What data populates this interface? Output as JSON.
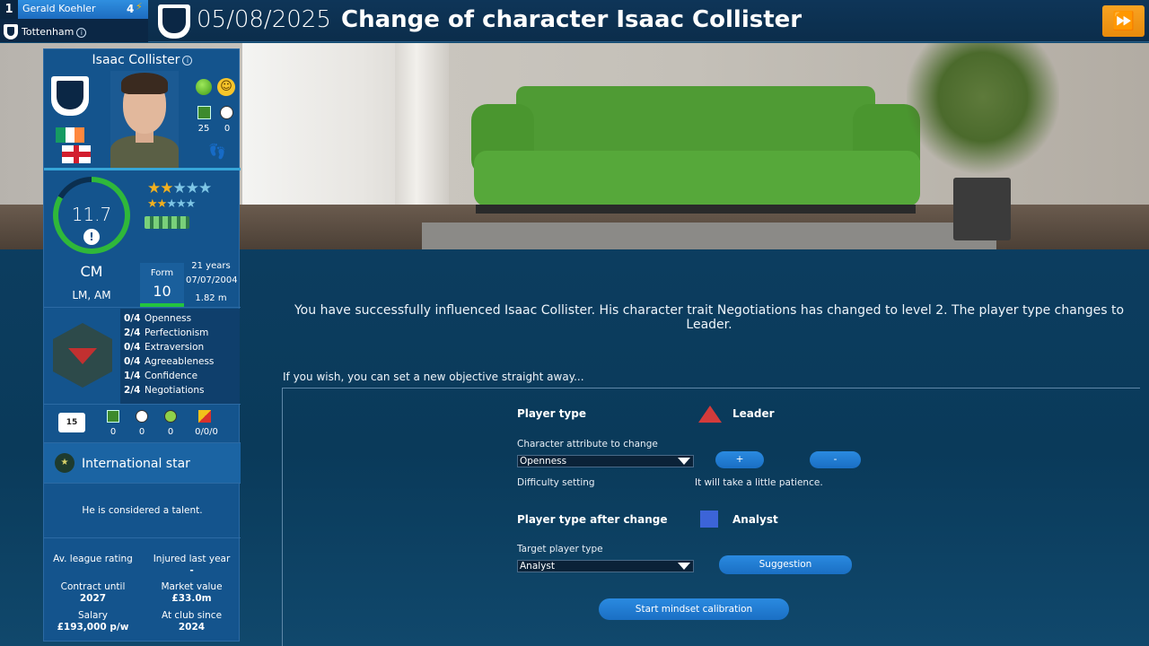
{
  "header": {
    "manager_rank": "1",
    "manager_name": "Gerald Koehler",
    "manager_points": "4",
    "club_name": "Tottenham",
    "date": "05/08/2025",
    "title": "Change of character Isaac Collister",
    "skip_icon": "fast-forward-icon"
  },
  "player": {
    "name": "Isaac Collister",
    "shirts_stat": "25",
    "goals_stat": "0",
    "rating": "11.7",
    "stars_gold": 2,
    "stars_total": 5,
    "position": "CM",
    "alt_positions": "LM, AM",
    "form_label": "Form",
    "form_value": "10",
    "age": "21 years",
    "dob": "07/07/2004",
    "height": "1.82 m",
    "traits": [
      {
        "level": "0/4",
        "name": "Openness"
      },
      {
        "level": "2/4",
        "name": "Perfectionism"
      },
      {
        "level": "0/4",
        "name": "Extraversion"
      },
      {
        "level": "0/4",
        "name": "Agreeableness"
      },
      {
        "level": "1/4",
        "name": "Confidence"
      },
      {
        "level": "2/4",
        "name": "Negotiations"
      }
    ],
    "shirt_number": "15",
    "mini_stats": [
      "0",
      "0",
      "0",
      "0/0/0"
    ],
    "status_label": "International star",
    "talent_text": "He is considered a talent.",
    "facts": {
      "league_rating_label": "Av. league rating",
      "league_rating_value": "",
      "injured_label": "Injured last year",
      "injured_value": "-",
      "contract_label": "Contract until",
      "contract_value": "2027",
      "market_label": "Market value",
      "market_value": "£33.0m",
      "salary_label": "Salary",
      "salary_value": "£193,000 p/w",
      "club_since_label": "At club since",
      "club_since_value": "2024"
    }
  },
  "main": {
    "message": "You have successfully influenced Isaac Collister. His character trait Negotiations has changed to level 2. The player type changes to Leader.",
    "objective_prompt": "If you wish, you can set a new objective straight away...",
    "player_type_label": "Player type",
    "player_type_value": "Leader",
    "attribute_label": "Character attribute to change",
    "attribute_value": "Openness",
    "plus_label": "+",
    "minus_label": "-",
    "difficulty_label": "Difficulty setting",
    "difficulty_value": "It will take a little patience.",
    "after_label": "Player type after change",
    "after_value": "Analyst",
    "target_label": "Target player type",
    "target_value": "Analyst",
    "suggestion_label": "Suggestion",
    "start_label": "Start mindset calibration"
  },
  "colors": {
    "accent_orange": "#e98b0c",
    "leader_red": "#d33b3b",
    "analyst_blue": "#3c64d8",
    "rating_green": "#2fb83a"
  }
}
